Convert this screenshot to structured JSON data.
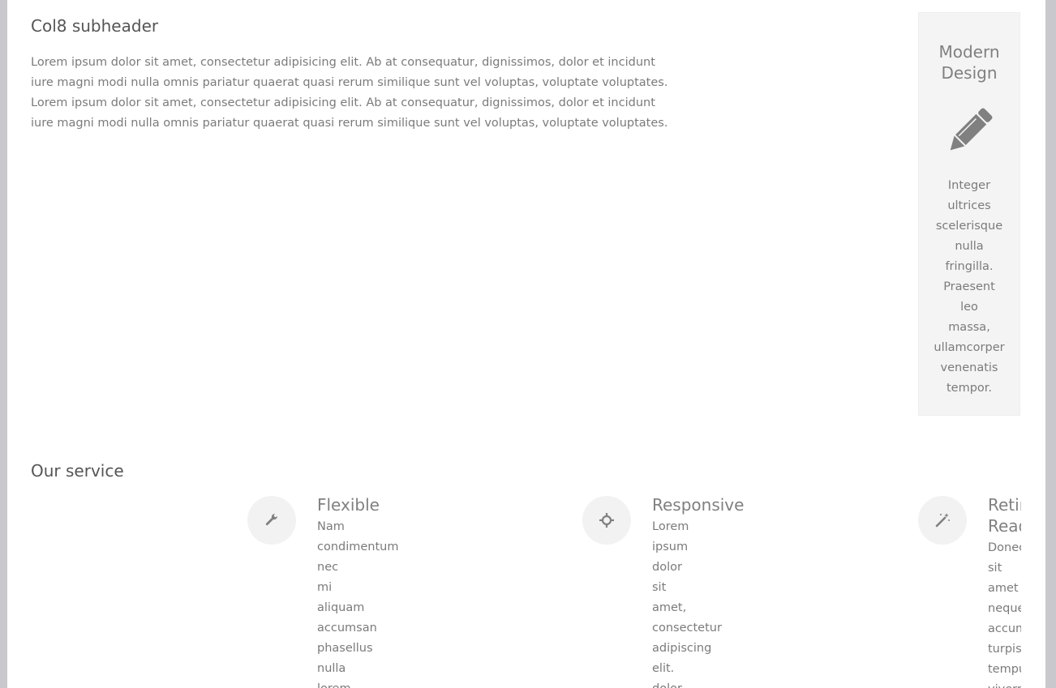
{
  "col8": {
    "subheader": "Col8 subheader",
    "paragraph": "Lorem ipsum dolor sit amet, consectetur adipisicing elit. Ab at consequatur, dignissimos, dolor et incidunt iure magni modi nulla omnis pariatur quaerat quasi rerum similique sunt vel voluptas, voluptate voluptates. Lorem ipsum dolor sit amet, consectetur adipisicing elit. Ab at consequatur, dignissimos, dolor et incidunt iure magni modi nulla omnis pariatur quaerat quasi rerum similique sunt vel voluptas, voluptate voluptates."
  },
  "feature": {
    "title": "Modern Design",
    "icon": "pencil-icon",
    "text": "Integer ultrices scelerisque nulla fringilla. Praesent leo massa, ullamcorper venenatis tempor."
  },
  "services": {
    "title": "Our service",
    "items": [
      {
        "title": "Flexible",
        "icon": "wrench-icon",
        "text": "Nam condimentum nec mi aliquam accumsan phasellus nulla lorem"
      },
      {
        "title": "Responsive",
        "icon": "crosshair-icon",
        "text": "Lorem ipsum dolor sit amet, consectetur adipiscing elit. dolor"
      },
      {
        "title": "Retina Ready",
        "icon": "magic-wand-icon",
        "text": "Donec sit amet neque accumsan turpis tempus viverra"
      }
    ]
  },
  "colors": {
    "page_background": "#c9c8cc",
    "content_background": "#ffffff",
    "panel_background": "#f4f4f4",
    "icon_gray": "#808080"
  }
}
